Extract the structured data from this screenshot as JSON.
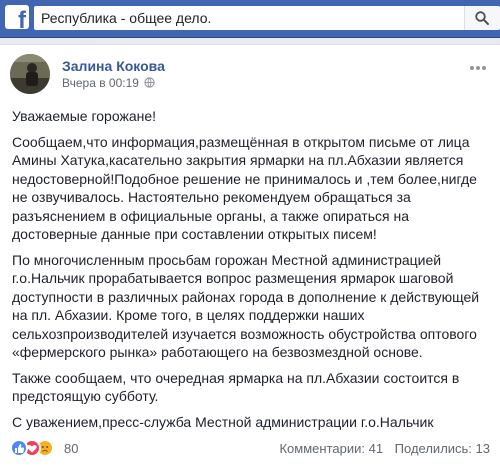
{
  "topbar": {
    "logo_icon": "facebook-logo-icon",
    "search_value": "Республика - общее дело.",
    "search_icon": "search-icon"
  },
  "post": {
    "author": "Залина Кокова",
    "timestamp": "Вчера в 00:19",
    "privacy_icon": "globe-icon",
    "paragraphs": [
      "Уважаемые горожане!",
      "Сообщаем,что информация,размещённая в открытом письме от лица Амины Хатука,касательно закрытия ярмарки на пл.Абхазии является недостоверной!Подобное решение не принималось и ,тем более,нигде не озвучивалось. Настоятельно рекомендуем обращаться за разъяснением в официальные органы, а также опираться на достоверные данные при составлении открытых писем!",
      "По многочисленным просьбам горожан Местной администрацией г.о.Нальчик прорабатывается вопрос размещения ярмарок шаговой доступности в различных районах города в дополнение к действующей на пл. Абхазии. Кроме того, в целях поддержки наших сельхозпроизводителей изучается возможность обустройства оптового «фермерского рынка» работающего на безвозмездной основе.",
      "Также сообщаем, что очередная ярмарка на пл.Абхазии состоится в предстоящую субботу.",
      "С уважением,пресс-служба Местной администрации г.о.Нальчик"
    ],
    "reactions": {
      "icons": [
        "like-icon",
        "love-icon",
        "sad-icon"
      ],
      "count": "80"
    },
    "comments": "Комментарии: 41",
    "shares": "Поделились: 13"
  },
  "colors": {
    "brand": "#4267b2",
    "link": "#385898",
    "text": "#1d2129",
    "muted": "#616770"
  }
}
